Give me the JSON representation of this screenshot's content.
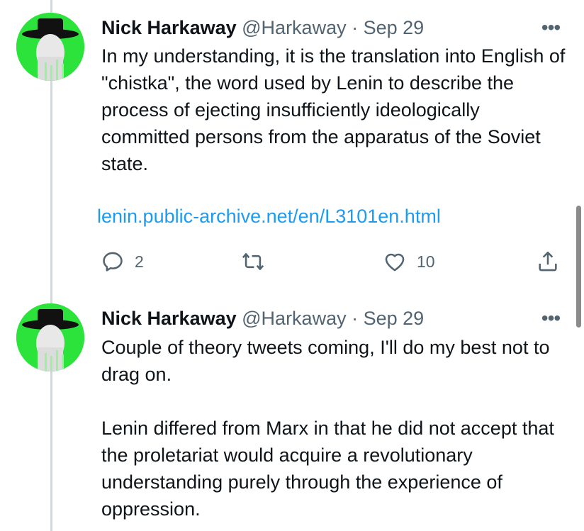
{
  "tweets": [
    {
      "author_name": "Nick Harkaway",
      "author_handle": "@Harkaway",
      "separator": "·",
      "date": "Sep 29",
      "more_label": "•••",
      "paragraphs": [
        "In my understanding, it is the translation into English of \"chistka\", the word used by Lenin to describe the process of ejecting insufficiently ideologically committed persons from the apparatus of the Soviet state."
      ],
      "link_text": "lenin.public-archive.net/en/L3101en.html",
      "reply_count": "2",
      "retweet_count": "",
      "like_count": "10"
    },
    {
      "author_name": "Nick Harkaway",
      "author_handle": "@Harkaway",
      "separator": "·",
      "date": "Sep 29",
      "more_label": "•••",
      "paragraphs": [
        "Couple of theory tweets coming, I'll do my best not to drag on.",
        "Lenin differed from Marx in that he did not accept that the proletariat would acquire a revolutionary understanding purely through the experience of oppression."
      ]
    }
  ],
  "colors": {
    "avatar_bg": "#2be33a",
    "link": "#1d9bf0",
    "muted": "#536471",
    "thread_line": "#cfd9de"
  },
  "icons": [
    "reply-icon",
    "retweet-icon",
    "like-icon",
    "share-icon",
    "more-icon"
  ]
}
